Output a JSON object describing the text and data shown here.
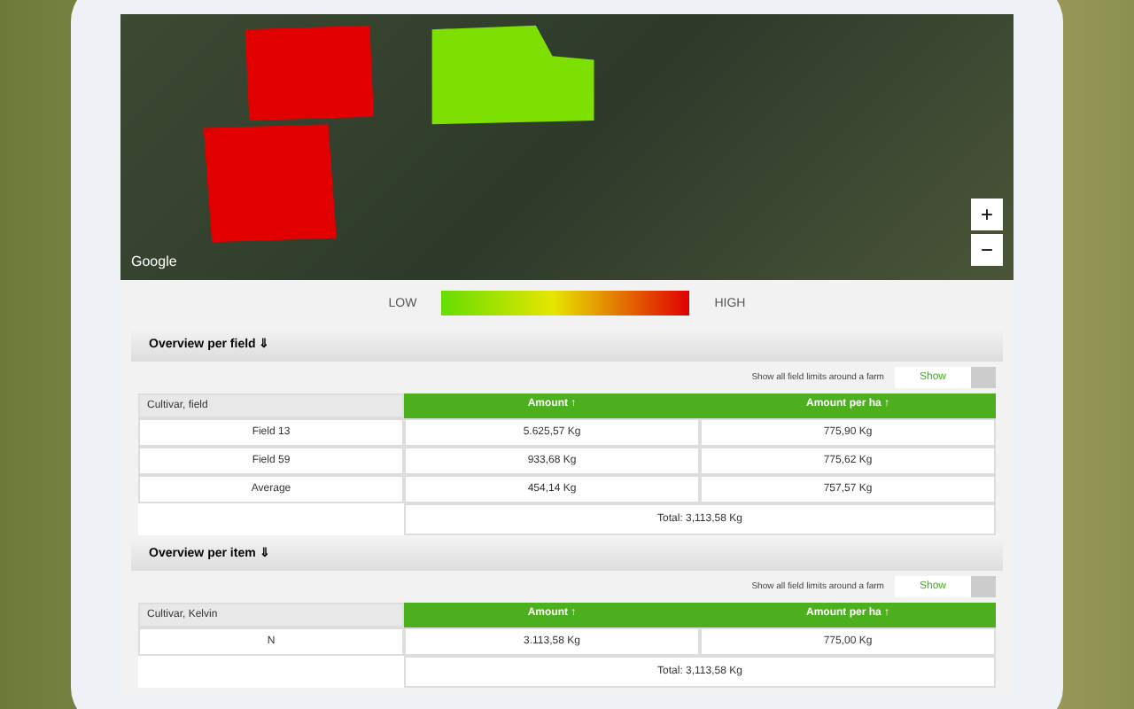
{
  "map": {
    "attribution": "Google",
    "zoom_in": "+",
    "zoom_out": "−",
    "fields": [
      {
        "color": "#e00000"
      },
      {
        "color": "#e00000"
      },
      {
        "color": "#7ee000"
      }
    ]
  },
  "legend": {
    "low": "LOW",
    "high": "HIGH"
  },
  "sections": [
    {
      "title": "Overview per field ⇓",
      "toggle_label": "Show all field limits around a farm",
      "toggle_value": "Show",
      "header_cell": "Cultivar, field",
      "amount_header": "Amount ↑",
      "per_ha_header": "Amount per ha ↑",
      "labels": [
        "Field 13",
        "Field 59",
        "Average"
      ],
      "amounts": [
        "5.625,57 Kg",
        "933,68 Kg",
        "454,14 Kg"
      ],
      "per_ha": [
        "775,90 Kg",
        "775,62 Kg",
        "757,57 Kg"
      ],
      "total": "Total: 3,113,58 Kg"
    },
    {
      "title": "Overview per item ⇓",
      "toggle_label": "Show all field limits around a farm",
      "toggle_value": "Show",
      "header_cell": "Cultivar, Kelvin",
      "amount_header": "Amount ↑",
      "per_ha_header": "Amount per ha ↑",
      "labels": [
        "N"
      ],
      "amounts": [
        "3.113,58 Kg"
      ],
      "per_ha": [
        "775,00 Kg"
      ],
      "total": "Total: 3,113,58 Kg"
    }
  ]
}
